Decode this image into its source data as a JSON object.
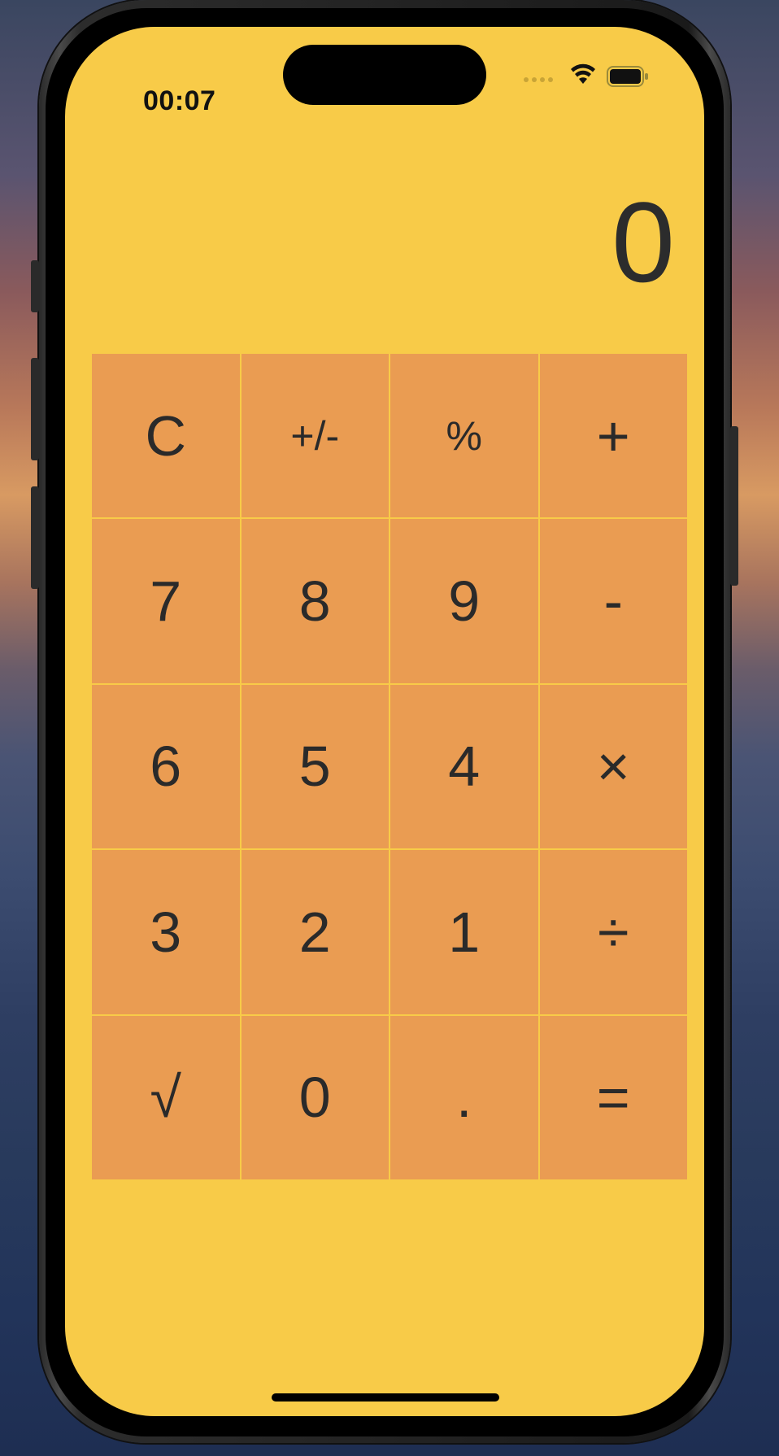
{
  "status_bar": {
    "time": "00:07"
  },
  "display": {
    "value": "0"
  },
  "keypad": {
    "keys": [
      {
        "label": "C",
        "name": "clear-button"
      },
      {
        "label": "+/-",
        "name": "sign-toggle-button"
      },
      {
        "label": "%",
        "name": "percent-button"
      },
      {
        "label": "+",
        "name": "add-button"
      },
      {
        "label": "7",
        "name": "digit-7-button"
      },
      {
        "label": "8",
        "name": "digit-8-button"
      },
      {
        "label": "9",
        "name": "digit-9-button"
      },
      {
        "label": "-",
        "name": "subtract-button"
      },
      {
        "label": "6",
        "name": "digit-6-button"
      },
      {
        "label": "5",
        "name": "digit-5-button"
      },
      {
        "label": "4",
        "name": "digit-4-button"
      },
      {
        "label": "×",
        "name": "multiply-button"
      },
      {
        "label": "3",
        "name": "digit-3-button"
      },
      {
        "label": "2",
        "name": "digit-2-button"
      },
      {
        "label": "1",
        "name": "digit-1-button"
      },
      {
        "label": "÷",
        "name": "divide-button"
      },
      {
        "label": "√",
        "name": "square-root-button"
      },
      {
        "label": "0",
        "name": "digit-0-button"
      },
      {
        "label": ".",
        "name": "decimal-button"
      },
      {
        "label": "=",
        "name": "equals-button"
      }
    ]
  },
  "colors": {
    "background": "#f8cb48",
    "key": "#ea9c52",
    "text": "#2a2a2a"
  }
}
